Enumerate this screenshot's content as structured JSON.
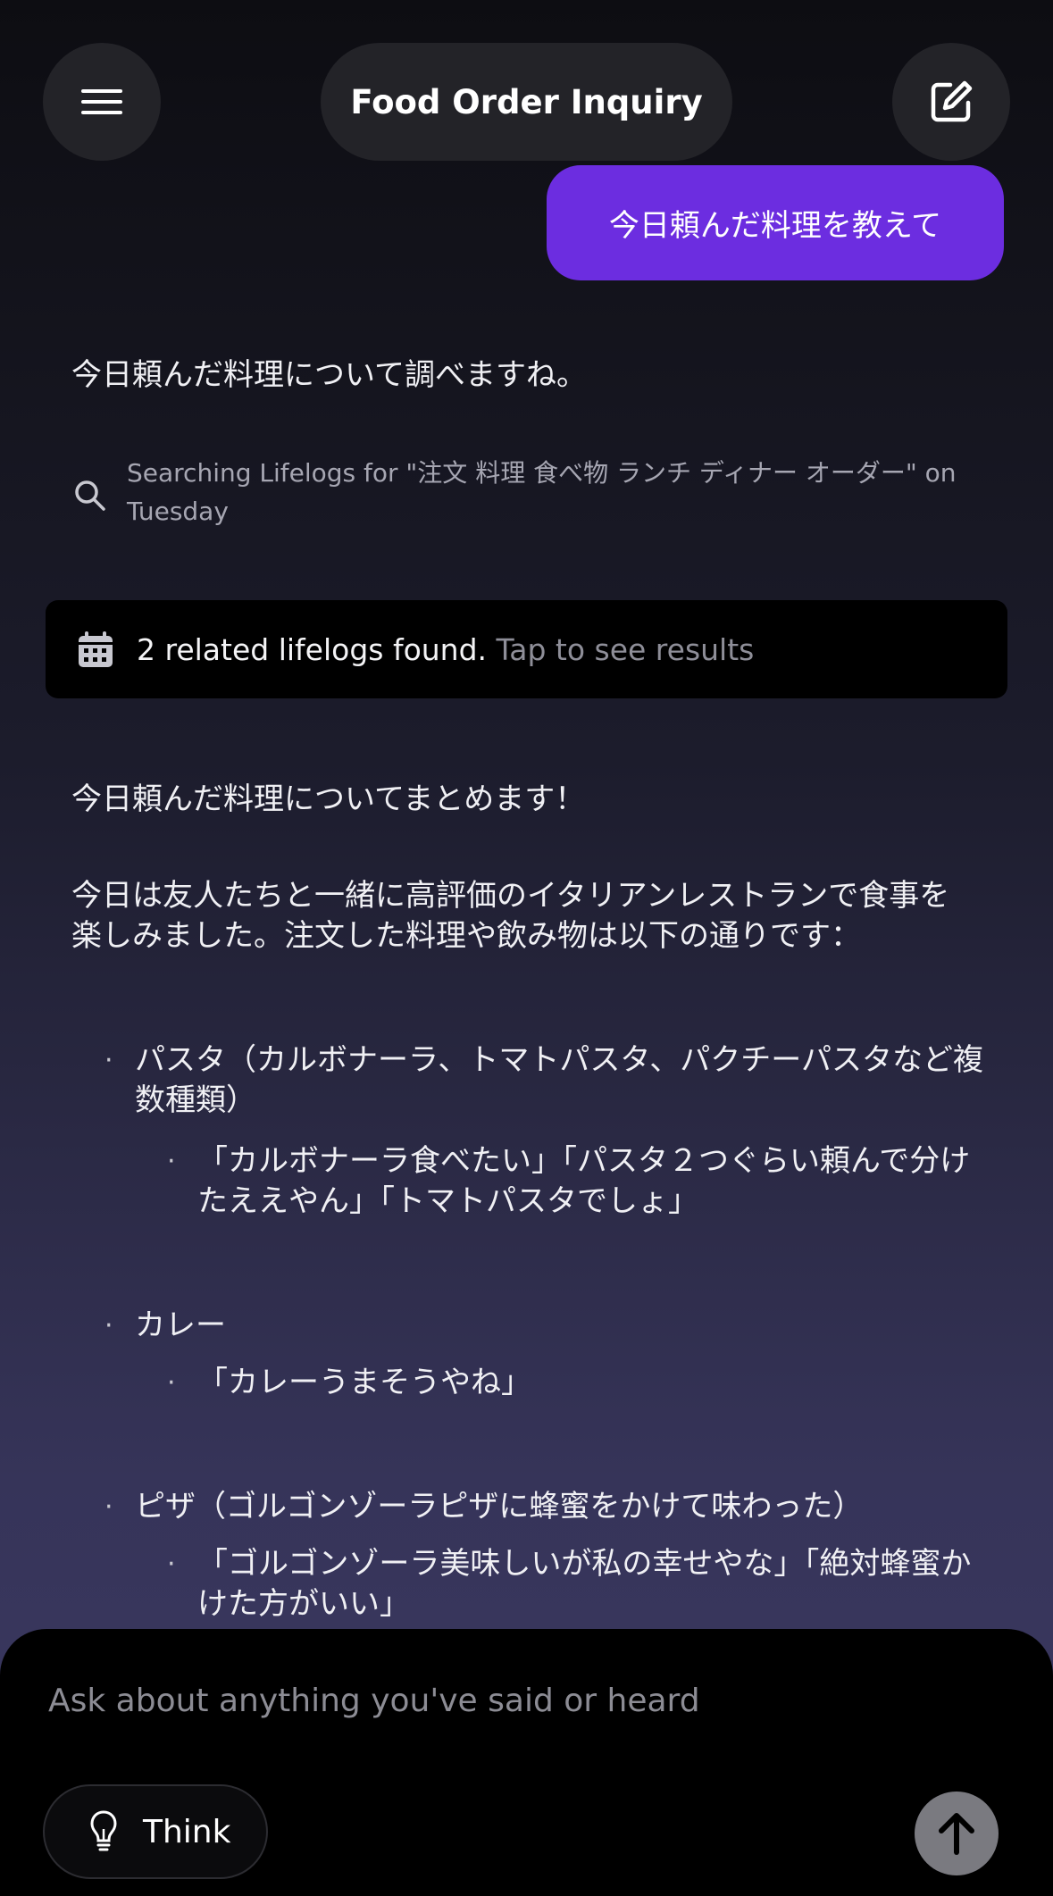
{
  "header": {
    "title": "Food Order Inquiry",
    "menu_icon": "hamburger-menu-icon",
    "compose_icon": "new-chat-edit-icon"
  },
  "conversation": {
    "user_message": "今日頼んだ料理を教えて",
    "assistant_intro": "今日頼んだ料理について調べますね。",
    "search_status": "Searching Lifelogs for \"注文 料理 食べ物 ランチ ディナー オーダー\" on Tuesday",
    "lifelog_card": {
      "found_text": "2 related lifelogs found.",
      "link_text": "Tap to see results"
    },
    "summary_heading": "今日頼んだ料理についてまとめます！",
    "summary_body": "今日は友人たちと一緒に高評価のイタリアンレストランで食事を楽しみました。注文した料理や飲み物は以下の通りです：",
    "items": [
      {
        "dish": "パスタ（カルボナーラ、トマトパスタ、パクチーパスタなど複数種類）",
        "quote": "「カルボナーラ食べたい」「パスタ２つぐらい頼んで分けたええやん」「トマトパスタでしょ」"
      },
      {
        "dish": "カレー",
        "quote": "「カレーうまそうやね」"
      },
      {
        "dish": "ピザ（ゴルゴンゾーラピザに蜂蜜をかけて味わった）",
        "quote": "「ゴルゴンゾーラ美味しいが私の幸せやな」「絶対蜂蜜かけた方がいい」"
      }
    ],
    "bullet_glyph": "·"
  },
  "composer": {
    "placeholder": "Ask about anything you've said or heard",
    "think_label": "Think",
    "send_icon": "arrow-up-icon",
    "think_icon": "lightbulb-icon"
  },
  "colors": {
    "accent_bubble": "#6c2de0",
    "card_bg": "#000000",
    "pill_bg": "#232328",
    "send_button": "#7a7a80"
  }
}
